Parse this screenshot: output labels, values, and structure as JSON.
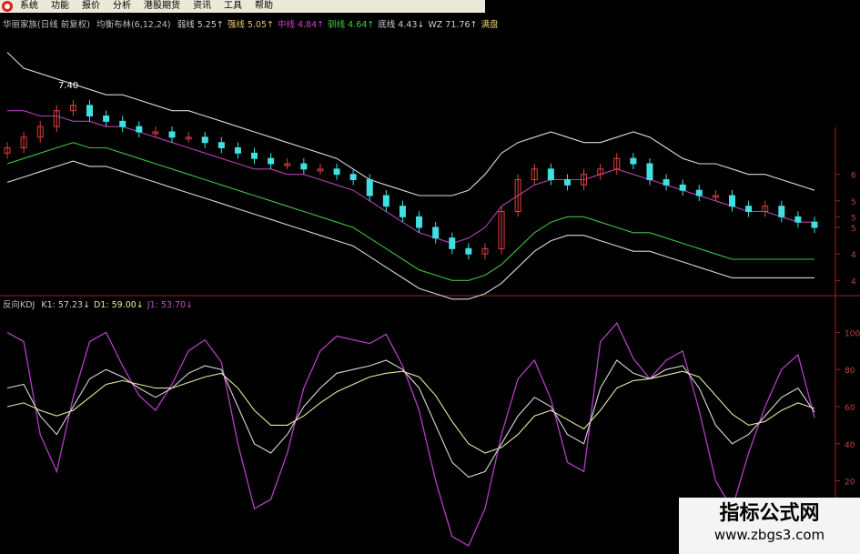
{
  "menu": [
    "系统",
    "功能",
    "报价",
    "分析",
    "港股期货",
    "资讯",
    "工具",
    "帮助"
  ],
  "main_legend": {
    "stock": "华丽家族(日线 前复权)",
    "indicator": "均衡布林(6,12,24)",
    "items": [
      {
        "label": "弱线",
        "value": "5.25",
        "arrow": "↑",
        "color": "#d0d0d0"
      },
      {
        "label": "强线",
        "value": "5.05",
        "arrow": "↑",
        "color": "#e8c870"
      },
      {
        "label": "中线",
        "value": "4.84",
        "arrow": "↑",
        "color": "#d040d0"
      },
      {
        "label": "驯线",
        "value": "4.64",
        "arrow": "↑",
        "color": "#40d040"
      },
      {
        "label": "底线",
        "value": "4.43",
        "arrow": "↓",
        "color": "#d0d0d0"
      },
      {
        "label": "WZ",
        "value": "71.76",
        "arrow": "↑",
        "color": "#d0d0d0"
      },
      {
        "label": "满盘",
        "value": "",
        "arrow": "",
        "color": "#e8c870"
      }
    ]
  },
  "kdj_legend": {
    "name": "反向KDJ",
    "items": [
      {
        "label": "K1",
        "value": "57.23",
        "arrow": "↓",
        "color": "#d0d0d0"
      },
      {
        "label": "D1",
        "value": "59.00",
        "arrow": "↓",
        "color": "#e8e890"
      },
      {
        "label": "J1",
        "value": "53.70",
        "arrow": "↓",
        "color": "#c050c0"
      }
    ]
  },
  "price_annotation": "7.40",
  "right_axis_price": [
    "6",
    "5",
    "5",
    "5",
    "4",
    "4"
  ],
  "right_axis_kdj": [
    "100",
    "80",
    "60",
    "40",
    "20"
  ],
  "colors": {
    "up": "#e04040",
    "down": "#40e0e0",
    "axis": "#a02020"
  },
  "watermark": {
    "title": "指标公式网",
    "url": "www.zbgs3.com"
  },
  "chart_data": {
    "type": "line",
    "title": "",
    "price_series": {
      "close": [
        6.5,
        6.7,
        6.9,
        7.2,
        7.3,
        7.1,
        7.0,
        6.9,
        6.8,
        6.8,
        6.7,
        6.7,
        6.6,
        6.5,
        6.4,
        6.3,
        6.2,
        6.2,
        6.1,
        6.1,
        6.0,
        5.9,
        5.6,
        5.4,
        5.2,
        5.0,
        4.8,
        4.6,
        4.5,
        4.6,
        5.3,
        5.9,
        6.1,
        5.9,
        5.8,
        6.0,
        6.1,
        6.3,
        6.2,
        5.9,
        5.8,
        5.7,
        5.6,
        5.6,
        5.4,
        5.3,
        5.4,
        5.2,
        5.1,
        5.0
      ],
      "upper": [
        8.3,
        8.0,
        7.9,
        7.8,
        7.7,
        7.6,
        7.5,
        7.5,
        7.4,
        7.3,
        7.2,
        7.2,
        7.1,
        7.0,
        6.9,
        6.8,
        6.7,
        6.6,
        6.5,
        6.4,
        6.3,
        6.1,
        5.9,
        5.8,
        5.7,
        5.6,
        5.6,
        5.6,
        5.7,
        6.0,
        6.4,
        6.6,
        6.7,
        6.8,
        6.7,
        6.6,
        6.6,
        6.7,
        6.8,
        6.7,
        6.5,
        6.3,
        6.2,
        6.2,
        6.1,
        6.0,
        6.0,
        5.9,
        5.8,
        5.7
      ],
      "middle": [
        7.2,
        7.2,
        7.1,
        7.1,
        7.0,
        7.0,
        6.9,
        6.9,
        6.8,
        6.7,
        6.6,
        6.5,
        6.4,
        6.3,
        6.2,
        6.1,
        6.1,
        6.0,
        6.0,
        5.9,
        5.8,
        5.7,
        5.5,
        5.3,
        5.1,
        4.9,
        4.8,
        4.7,
        4.8,
        5.0,
        5.4,
        5.6,
        5.8,
        5.9,
        5.9,
        5.9,
        6.0,
        6.1,
        6.0,
        5.9,
        5.8,
        5.7,
        5.6,
        5.5,
        5.4,
        5.3,
        5.3,
        5.2,
        5.1,
        5.1
      ],
      "lower": [
        6.2,
        6.3,
        6.4,
        6.5,
        6.6,
        6.5,
        6.5,
        6.4,
        6.3,
        6.2,
        6.1,
        6.0,
        5.9,
        5.8,
        5.7,
        5.6,
        5.5,
        5.4,
        5.3,
        5.2,
        5.1,
        5.0,
        4.8,
        4.6,
        4.4,
        4.2,
        4.1,
        4.0,
        4.0,
        4.1,
        4.3,
        4.6,
        4.9,
        5.1,
        5.2,
        5.2,
        5.1,
        5.0,
        4.9,
        4.9,
        4.8,
        4.7,
        4.6,
        4.5,
        4.4,
        4.4,
        4.4,
        4.4,
        4.4,
        4.4
      ]
    },
    "kdj_series": {
      "K1": [
        70,
        72,
        55,
        45,
        60,
        75,
        80,
        76,
        70,
        65,
        70,
        78,
        82,
        80,
        60,
        40,
        35,
        45,
        60,
        70,
        78,
        80,
        82,
        85,
        80,
        70,
        50,
        30,
        22,
        25,
        40,
        55,
        65,
        60,
        45,
        40,
        70,
        85,
        78,
        75,
        80,
        82,
        70,
        50,
        40,
        45,
        55,
        65,
        70,
        57
      ],
      "D1": [
        60,
        62,
        58,
        55,
        58,
        65,
        72,
        74,
        72,
        70,
        70,
        73,
        76,
        78,
        70,
        58,
        50,
        50,
        55,
        62,
        68,
        72,
        76,
        78,
        79,
        76,
        66,
        52,
        40,
        35,
        38,
        45,
        55,
        58,
        53,
        48,
        58,
        70,
        74,
        75,
        77,
        79,
        76,
        66,
        56,
        50,
        52,
        58,
        62,
        59
      ],
      "J1": [
        100,
        95,
        45,
        25,
        65,
        95,
        100,
        82,
        66,
        58,
        72,
        90,
        96,
        84,
        40,
        5,
        10,
        35,
        70,
        90,
        98,
        96,
        94,
        99,
        82,
        58,
        20,
        -10,
        -15,
        5,
        45,
        75,
        85,
        64,
        30,
        25,
        95,
        105,
        86,
        75,
        85,
        90,
        58,
        20,
        5,
        35,
        60,
        80,
        88,
        54
      ]
    }
  }
}
